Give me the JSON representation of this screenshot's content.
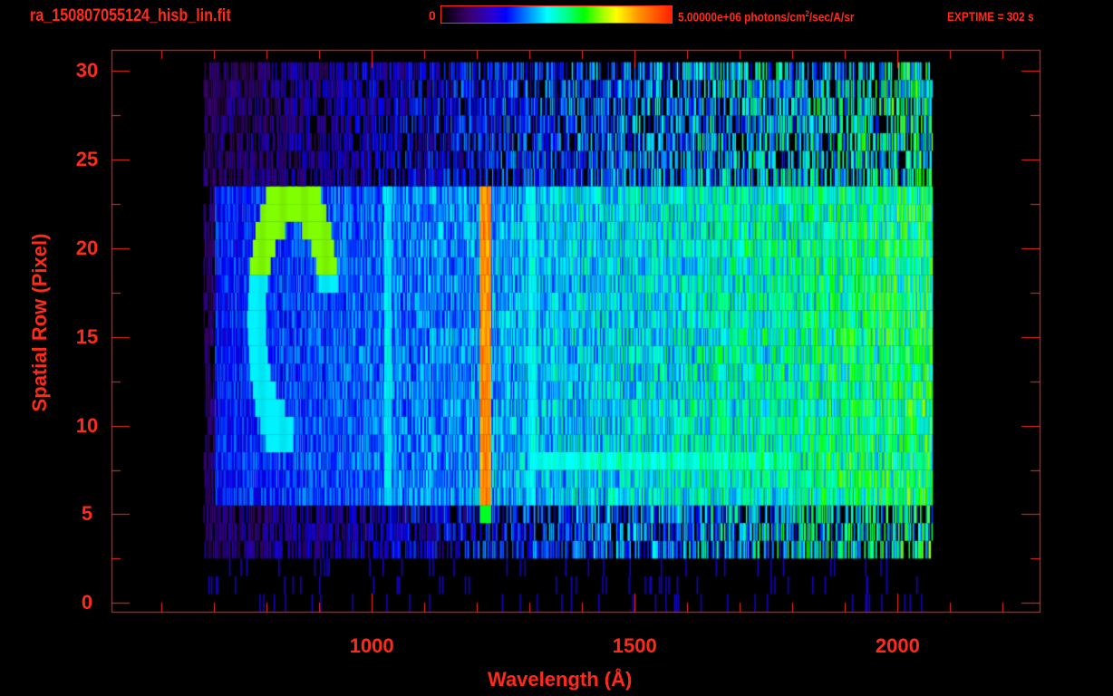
{
  "header": {
    "title": "ra_150807055124_hisb_lin.fit",
    "colorbar_min_label": "0",
    "colorbar_max_label": "5.00000e+06 photons/cm",
    "colorbar_max_sup": "2",
    "colorbar_max_suffix": "/sec/A/sr",
    "exptime": "EXPTIME = 302 s"
  },
  "chart_data": {
    "type": "heatmap",
    "title": "ra_150807055124_hisb_lin.fit",
    "xlabel": "Wavelength (Å)",
    "ylabel": "Spatial Row (Pixel)",
    "xlim": [
      505,
      2270
    ],
    "ylim": [
      -0.5,
      31.2
    ],
    "x_major_ticks": [
      1000,
      1500,
      2000
    ],
    "x_tick_labels": [
      "1000",
      "1500",
      "2000"
    ],
    "x_minor_step": 100,
    "y_major_ticks": [
      0,
      5,
      10,
      15,
      20,
      25,
      30
    ],
    "y_tick_labels": [
      "0",
      "5",
      "10",
      "15",
      "20",
      "25",
      "30"
    ],
    "y_minor_step": 2.5,
    "colorbar": {
      "min": 0,
      "max": 5000000,
      "units": "photons/cm^2/sec/A/sr"
    },
    "colormap": [
      "#000000",
      "#3a006e",
      "#0000ff",
      "#00ffff",
      "#00ff00",
      "#ffff00",
      "#ff2000"
    ],
    "grid": false,
    "data_extent": {
      "wavelength": [
        680,
        2065
      ],
      "rows": [
        0,
        30
      ],
      "bright_rows": [
        6,
        23
      ]
    },
    "features": [
      {
        "name": "Lyman-alpha",
        "wavelength": 1216,
        "rows": [
          5,
          23
        ],
        "relative_intensity": 0.9
      },
      {
        "name": "line",
        "wavelength": 1030,
        "rows": [
          6,
          23
        ],
        "relative_intensity": 0.45
      },
      {
        "name": "line",
        "wavelength": 1304,
        "rows": [
          6,
          23
        ],
        "relative_intensity": 0.45
      },
      {
        "name": "line",
        "wavelength": 1356,
        "rows": [
          6,
          23
        ],
        "relative_intensity": 0.38
      },
      {
        "name": "bright-arc",
        "wavelength": [
          800,
          900
        ],
        "rows": [
          9,
          23
        ],
        "relative_intensity": 0.68
      },
      {
        "name": "bright-row",
        "wavelength": [
          1300,
          1800
        ],
        "rows": [
          8,
          8
        ],
        "relative_intensity": 0.45
      }
    ]
  }
}
